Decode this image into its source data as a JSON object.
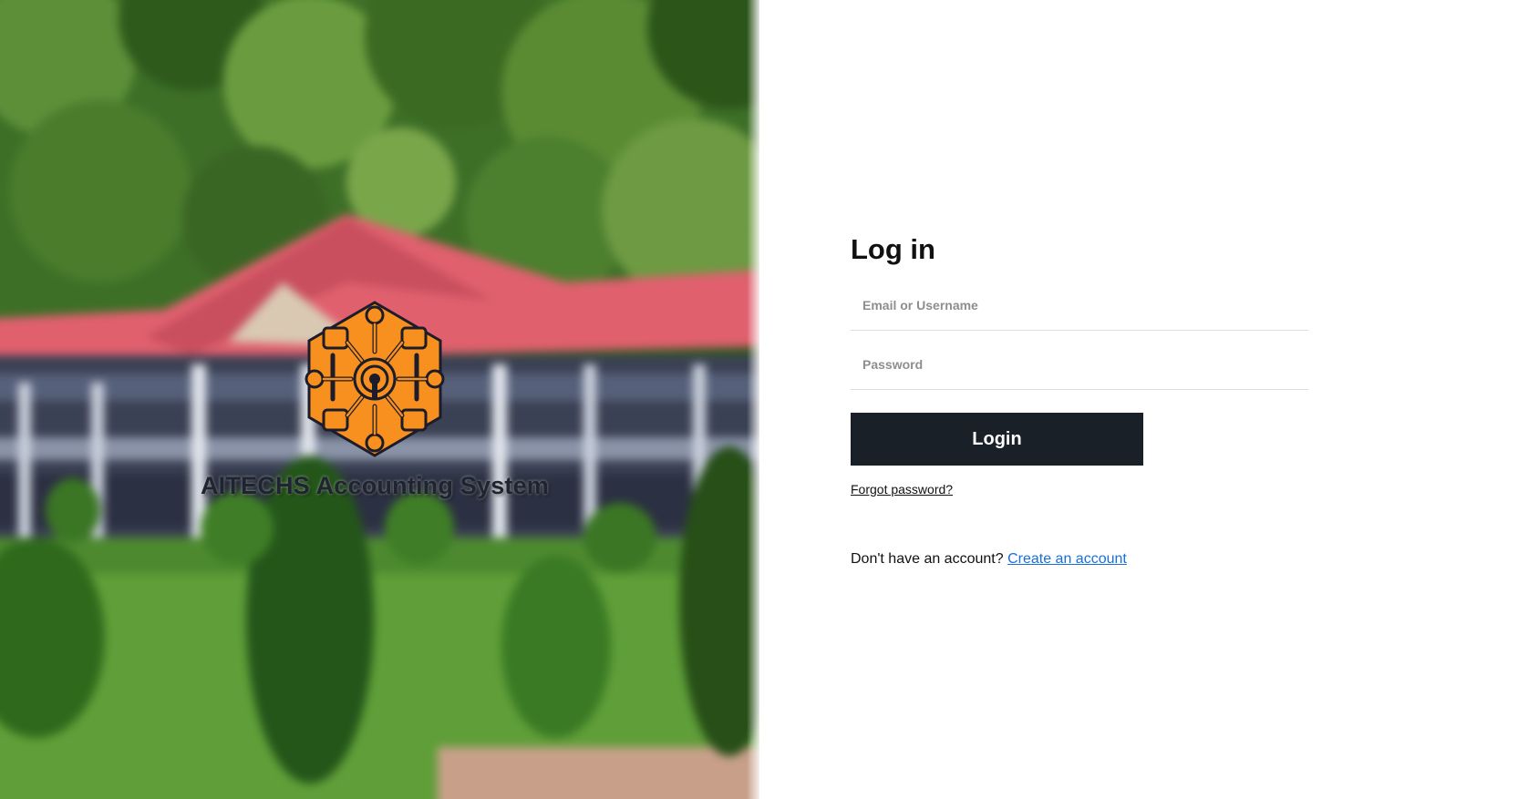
{
  "brand": {
    "name": "AITECHS Accounting System",
    "logo_icon": "circuit-hexagon-logo",
    "logo_color": "#f7901e"
  },
  "login": {
    "title": "Log in",
    "username_placeholder": "Email or Username",
    "password_placeholder": "Password",
    "submit_label": "Login",
    "forgot_password": "Forgot password?",
    "signup_prompt": "Don't have an account?",
    "signup_link": "Create an account"
  },
  "colors": {
    "button_bg": "#1a2028",
    "link": "#1a6fdb",
    "heading": "#111111"
  }
}
